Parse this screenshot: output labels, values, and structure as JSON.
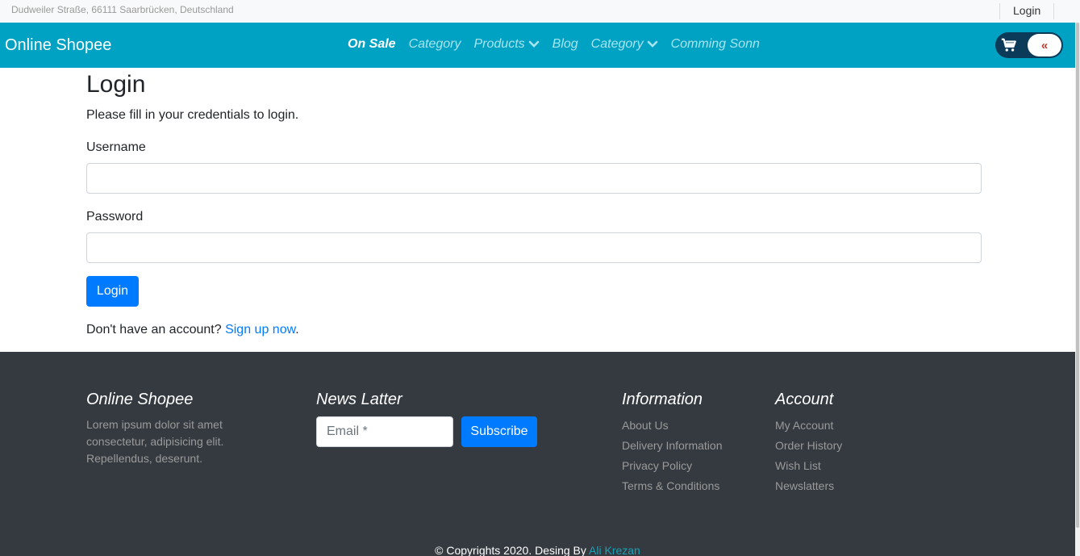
{
  "topbar": {
    "address": "Dudweiler Straße, 66111 Saarbrücken, Deutschland",
    "login_label": "Login"
  },
  "navbar": {
    "brand": "Online Shopee",
    "items": [
      {
        "label": "On Sale",
        "active": true,
        "dropdown": false
      },
      {
        "label": "Category",
        "active": false,
        "dropdown": false
      },
      {
        "label": "Products",
        "active": false,
        "dropdown": true
      },
      {
        "label": "Blog",
        "active": false,
        "dropdown": false
      },
      {
        "label": "Category",
        "active": false,
        "dropdown": true
      },
      {
        "label": "Comming Sonn",
        "active": false,
        "dropdown": false
      }
    ],
    "cart_icon": "cart-icon",
    "toggle_glyph": "«"
  },
  "login_form": {
    "title": "Login",
    "subtitle": "Please fill in your credentials to login.",
    "username_label": "Username",
    "username_value": "",
    "password_label": "Password",
    "password_value": "",
    "submit_label": "Login",
    "signup_prompt": "Don't have an account?",
    "signup_link": "Sign up now",
    "signup_suffix": "."
  },
  "footer": {
    "about": {
      "heading": "Online Shopee",
      "text": "Lorem ipsum dolor sit amet consectetur, adipisicing elit. Repellendus, deserunt."
    },
    "newsletter": {
      "heading": "News Latter",
      "email_placeholder": "Email *",
      "subscribe_label": "Subscribe"
    },
    "information": {
      "heading": "Information",
      "links": [
        "About Us",
        "Delivery Information",
        "Privacy Policy",
        "Terms & Conditions"
      ]
    },
    "account": {
      "heading": "Account",
      "links": [
        "My Account",
        "Order History",
        "Wish List",
        "Newslatters"
      ]
    },
    "copyright_text": "© Copyrights 2020. Desing By",
    "copyright_author": "Ali Krezan"
  },
  "colors": {
    "navbar_bg": "#00a2c3",
    "footer_bg": "#343a40",
    "primary": "#007bff",
    "link_accent": "#17a2b8"
  }
}
